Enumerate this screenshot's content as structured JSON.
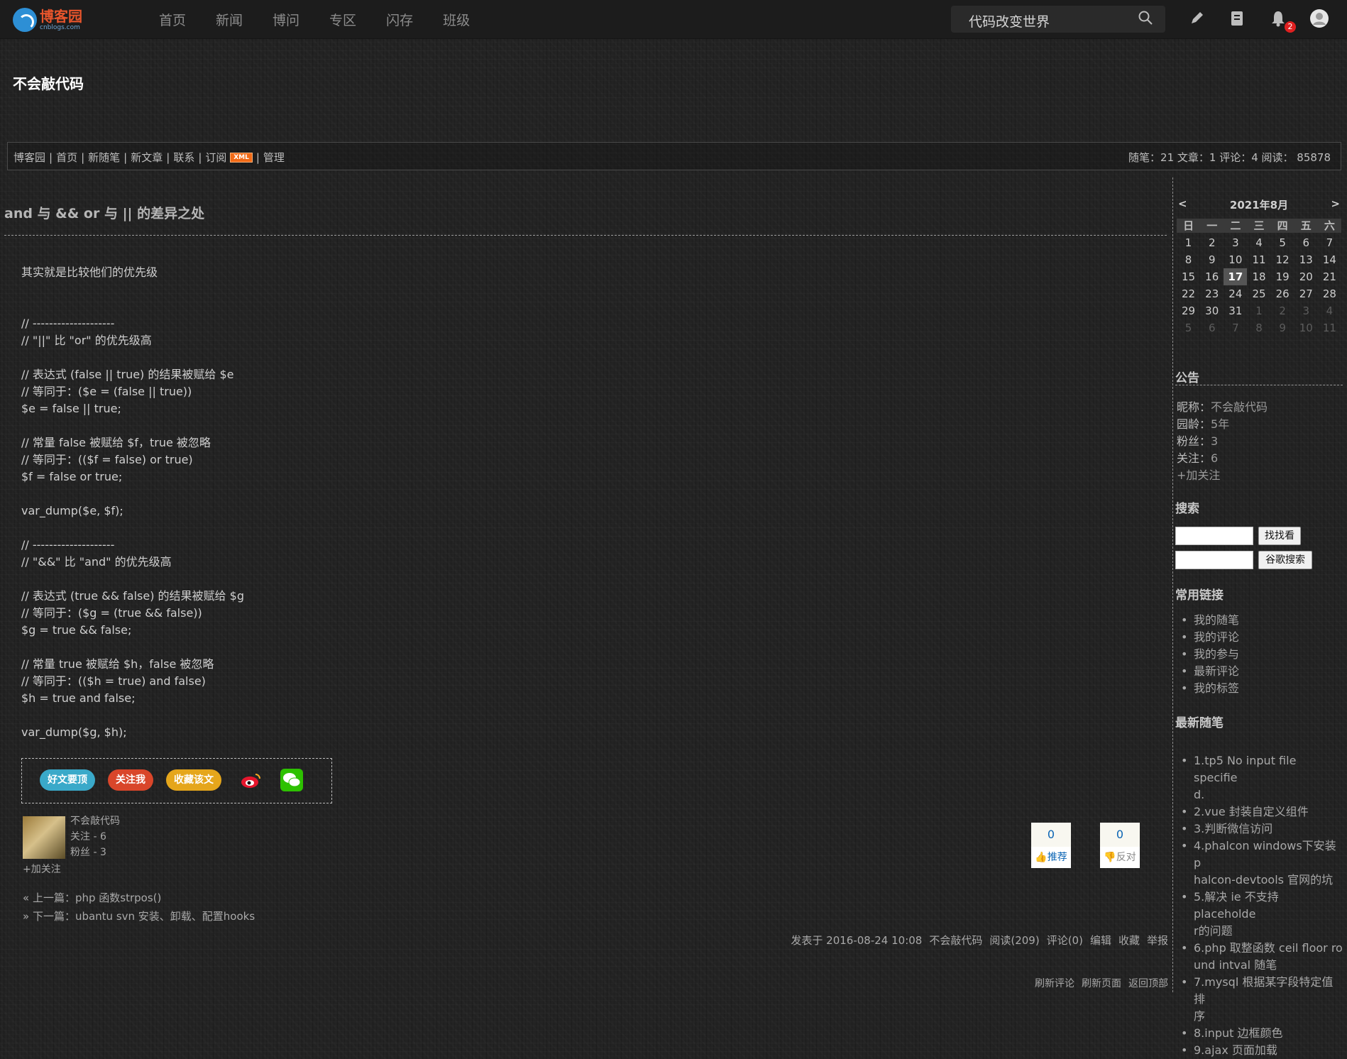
{
  "header": {
    "logo_text": "博客园",
    "logo_sub": "cnblogs.com",
    "nav": [
      "首页",
      "新闻",
      "博问",
      "专区",
      "闪存",
      "班级"
    ],
    "search_value": "代码改变世界",
    "notification_count": "2"
  },
  "blog": {
    "title": "不会敲代码",
    "navlinks": [
      "博客园",
      "首页",
      "新随笔",
      "新文章",
      "联系",
      "订阅",
      "管理"
    ],
    "xml_badge": "XML",
    "stats": "随笔：21 文章：1 评论：4 阅读： 85878"
  },
  "post": {
    "title": "and 与 && or 与 || 的差异之处",
    "lines": [
      "其实就是比较他们的优先级",
      "",
      "",
      "// --------------------",
      "// \"||\" 比 \"or\" 的优先级高",
      "",
      "// 表达式 (false || true) 的结果被赋给 $e",
      "// 等同于：($e = (false || true))",
      "$e = false || true;",
      "",
      "// 常量 false 被赋给 $f，true 被忽略",
      "// 等同于：(($f = false) or true)",
      "$f = false or true;",
      "",
      "var_dump($e, $f);",
      "",
      "// --------------------",
      "// \"&&\" 比 \"and\" 的优先级高",
      "",
      "// 表达式 (true && false) 的结果被赋给 $g",
      "// 等同于：($g = (true && false))",
      "$g = true && false;",
      "",
      "// 常量 true 被赋给 $h，false 被忽略",
      "// 等同于：(($h = true) and false)",
      "$h = true and false;",
      "",
      "var_dump($g, $h);"
    ],
    "share_buttons": [
      "好文要顶",
      "关注我",
      "收藏该文"
    ],
    "author_name": "不会敲代码",
    "author_follow": "关注 - 6",
    "author_fans": "粉丝 - 3",
    "follow_link": "+加关注",
    "prev_label": "« 上一篇：",
    "prev_title": "php 函数strpos()",
    "next_label": "» 下一篇：",
    "next_title": "ubantu svn 安装、卸载、配置hooks",
    "digg_count": "0",
    "digg_label": "推荐",
    "bury_count": "0",
    "bury_label": "反对",
    "footer_items": [
      "发表于 2016-08-24 10:08",
      "不会敲代码",
      "阅读(209)",
      "评论(0)",
      "编辑",
      "收藏",
      "举报"
    ],
    "footer2_items": [
      "刷新评论",
      "刷新页面",
      "返回顶部"
    ]
  },
  "sidebar": {
    "calendar": {
      "prev": "<",
      "title": "2021年8月",
      "next": ">",
      "weekdays": [
        "日",
        "一",
        "二",
        "三",
        "四",
        "五",
        "六"
      ],
      "weeks": [
        [
          "1",
          "2",
          "3",
          "4",
          "5",
          "6",
          "7"
        ],
        [
          "8",
          "9",
          "10",
          "11",
          "12",
          "13",
          "14"
        ],
        [
          "15",
          "16",
          "17",
          "18",
          "19",
          "20",
          "21"
        ],
        [
          "22",
          "23",
          "24",
          "25",
          "26",
          "27",
          "28"
        ],
        [
          "29",
          "30",
          "31",
          "1",
          "2",
          "3",
          "4"
        ],
        [
          "5",
          "6",
          "7",
          "8",
          "9",
          "10",
          "11"
        ]
      ],
      "today": "17"
    },
    "notice_title": "公告",
    "notice": [
      {
        "k": "昵称：",
        "v": "不会敲代码"
      },
      {
        "k": "园龄：",
        "v": "5年"
      },
      {
        "k": "粉丝：",
        "v": "3"
      },
      {
        "k": "关注：",
        "v": "6"
      }
    ],
    "notice_follow": "+加关注",
    "search_title": "搜索",
    "search_btn": "找找看",
    "google_btn": "谷歌搜索",
    "links_title": "常用链接",
    "links": [
      "我的随笔",
      "我的评论",
      "我的参与",
      "最新评论",
      "我的标签"
    ],
    "recent_title": "最新随笔",
    "recent": [
      "1.tp5 No input file specifie",
      "d.",
      "2.vue 封装自定义组件",
      "3.判断微信访问",
      "4.phalcon windows下安装p",
      "halcon-devtools 官网的坑",
      "5.解决 ie 不支持 placeholde",
      "r的问题",
      "6.php 取整函数 ceil floor ro",
      "und intval 随笔",
      "7.mysql 根据某字段特定值排",
      "序",
      "8.input 边框颜色",
      "9.ajax 页面加载"
    ]
  }
}
